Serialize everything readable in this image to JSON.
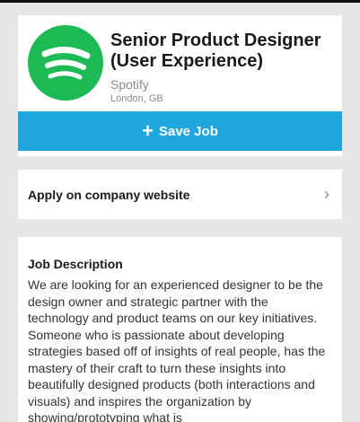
{
  "job": {
    "title": "Senior Product Designer (User Experience)",
    "company": "Spotify",
    "location": "London, GB",
    "logo_icon": "spotify-logo-icon",
    "brand_color": "#1db954"
  },
  "actions": {
    "save_label": "Save Job",
    "save_icon": "plus-icon",
    "save_color": "#1fa6dc",
    "apply_label": "Apply on company website",
    "apply_icon": "chevron-right-icon"
  },
  "description": {
    "heading": "Job Description",
    "body": "We are looking for an experienced designer to be the design owner and strategic partner with the technology and product teams on our key initiatives. Someone who is passionate about developing strategies based off of insights of real people, has the mastery of their craft to turn these insights into beautifully designed products (both interactions and visuals) and inspires the organization by showing/prototyping what is"
  }
}
